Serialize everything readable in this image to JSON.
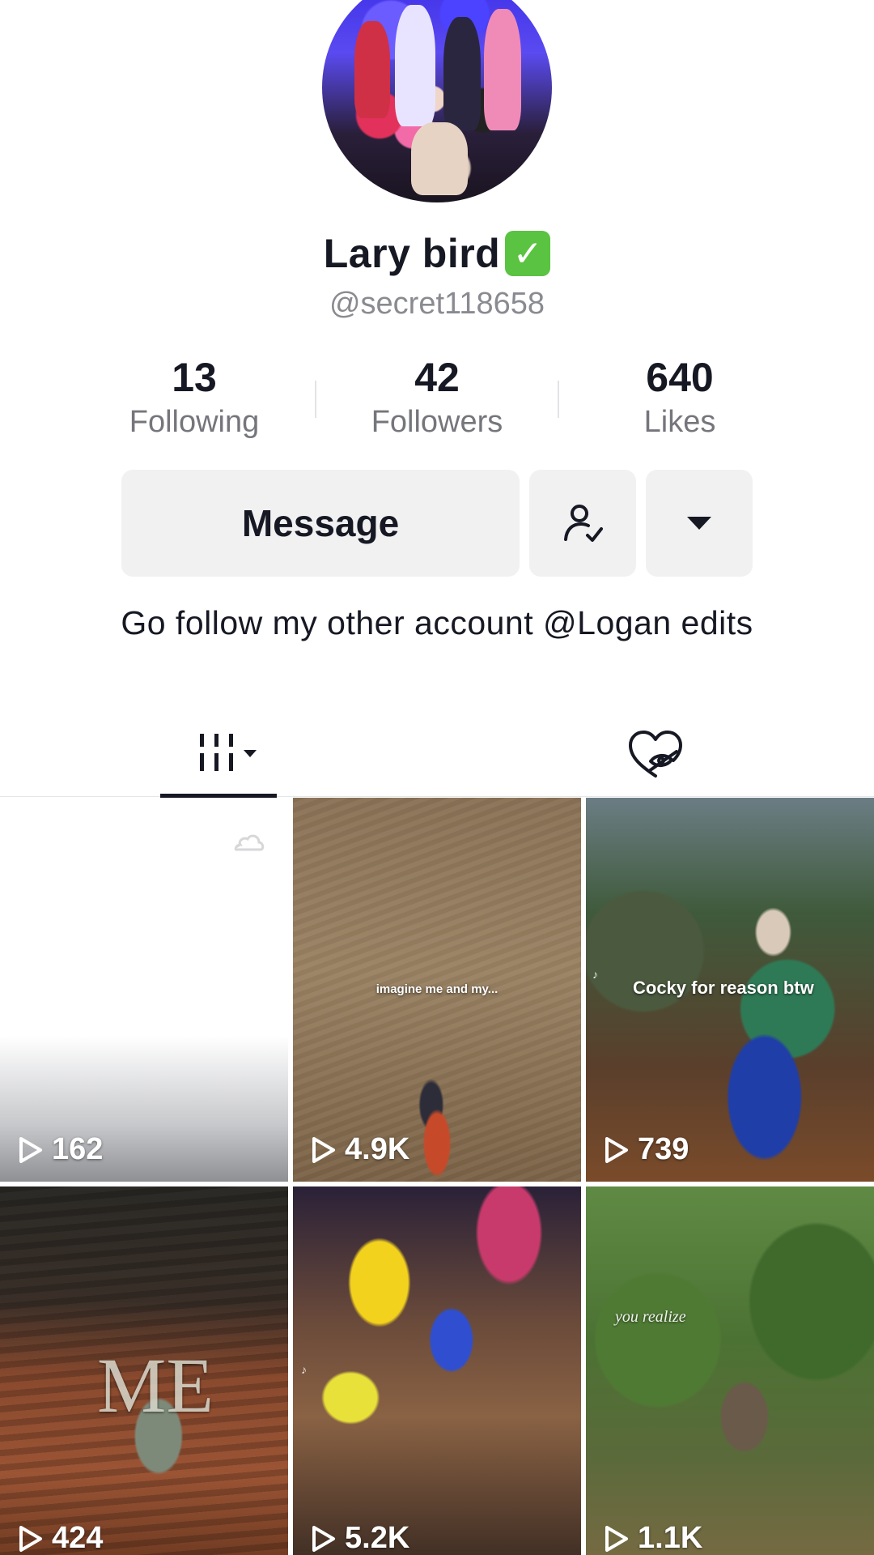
{
  "profile": {
    "name": "Lary bird",
    "verified_badge": "✅",
    "handle": "@secret118658",
    "bio": "Go follow my other account @Logan edits"
  },
  "stats": [
    {
      "value": "13",
      "label": "Following"
    },
    {
      "value": "42",
      "label": "Followers"
    },
    {
      "value": "640",
      "label": "Likes"
    }
  ],
  "actions": {
    "message_label": "Message",
    "friends_icon": "user-check-icon",
    "more_icon": "caret-down-icon"
  },
  "tabs": {
    "videos_icon": "grid-videos-icon",
    "liked_icon": "hidden-liked-icon"
  },
  "videos": [
    {
      "views": "162",
      "caption": ""
    },
    {
      "views": "4.9K",
      "caption": "imagine me and my..."
    },
    {
      "views": "739",
      "caption": "Cocky for reason btw"
    },
    {
      "views": "424",
      "caption": "ME"
    },
    {
      "views": "5.2K",
      "caption": ""
    },
    {
      "views": "1.1K",
      "caption": "you realize"
    }
  ],
  "colors": {
    "text": "#161823",
    "secondary": "#75767c",
    "button_bg": "#f1f1f2",
    "verified": "#5ac341"
  }
}
